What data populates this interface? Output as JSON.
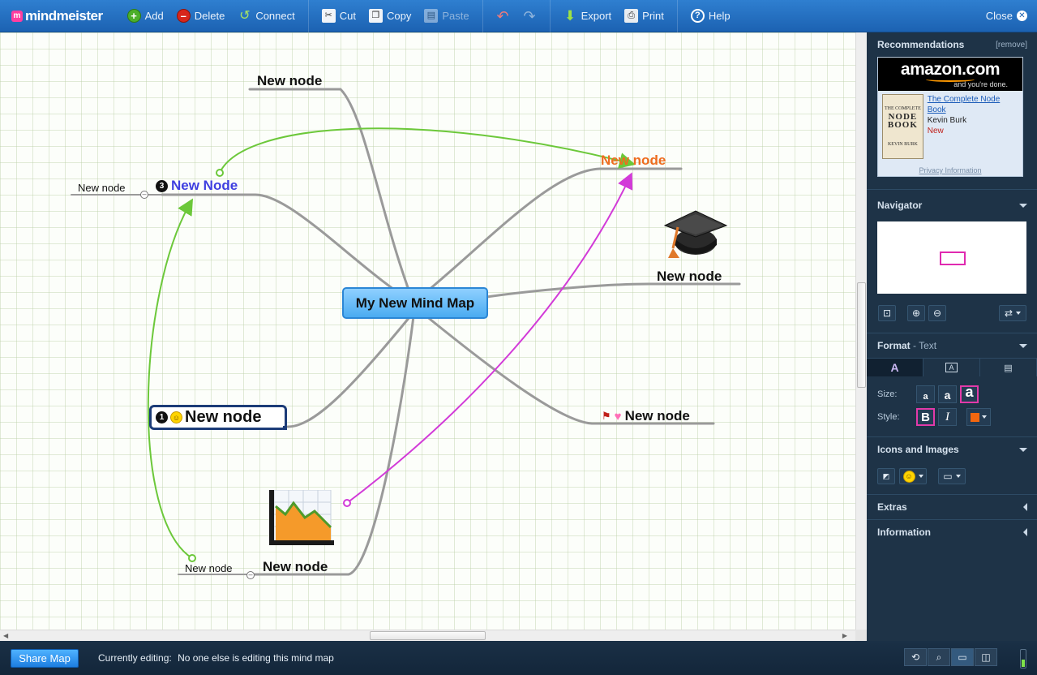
{
  "app": {
    "logo_mark": "m",
    "logo_text": "mindmeister"
  },
  "toolbar": {
    "add": "Add",
    "delete": "Delete",
    "connect": "Connect",
    "cut": "Cut",
    "copy": "Copy",
    "paste": "Paste",
    "export": "Export",
    "print": "Print",
    "help": "Help",
    "close": "Close"
  },
  "map": {
    "root": "My New Mind Map",
    "nodes": {
      "top_left": "New node",
      "new_node_blue": "New Node",
      "left_small": "New node",
      "top_right_orange": "New node",
      "right_middle": "New node",
      "bottom_right": "New node",
      "selected": "New node",
      "bottom_center": "New node",
      "bottom_left_small": "New node"
    },
    "badges": {
      "blue_node_number": "3",
      "selected_node_number": "1"
    }
  },
  "sidebar": {
    "recommendations": {
      "title": "Recommendations",
      "remove": "[remove]",
      "brand": "amazon.com",
      "tagline": "and you're done.",
      "book_cover_lines": [
        "THE COMPLETE",
        "NODE",
        "BOOK",
        "KEVIN BURK"
      ],
      "book_title": "The Complete Node Book",
      "author": "Kevin Burk",
      "condition": "New",
      "privacy": "Privacy Information"
    },
    "navigator": {
      "title": "Navigator"
    },
    "format": {
      "title": "Format",
      "subtitle": "- Text",
      "size_label": "Size:",
      "style_label": "Style:",
      "tab_text_glyph": "A",
      "size_glyph": "a",
      "bold_glyph": "B",
      "italic_glyph": "I",
      "text_color": "#f3670f"
    },
    "icons_images": {
      "title": "Icons and Images"
    },
    "extras": {
      "title": "Extras"
    },
    "information": {
      "title": "Information"
    }
  },
  "bottombar": {
    "share": "Share Map",
    "editing_label": "Currently editing:",
    "editing_value": "No one else is editing this mind map"
  },
  "colors": {
    "toolbar": "#1c62b2",
    "sidebar": "#1e3347",
    "link_green": "#6cc83a",
    "link_magenta": "#d23ad8",
    "branch_gray": "#9a9a9a",
    "orange_node": "#ee6c1f",
    "blue_node": "#3f3fe0"
  }
}
